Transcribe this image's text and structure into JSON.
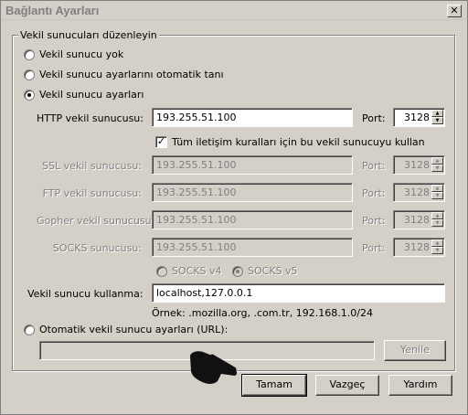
{
  "window": {
    "title": "Bağlantı Ayarları",
    "close_glyph": "✕"
  },
  "group": {
    "legend": "Vekil sunucuları düzenleyin"
  },
  "radios": {
    "no_proxy": "Vekil sunucu yok",
    "auto_detect": "Vekil sunucu ayarlarını otomatik tanı",
    "manual": "Vekil sunucu ayarları",
    "auto_url": "Otomatik vekil sunucu ayarları (URL):"
  },
  "selected_mode": "manual",
  "port_label": "Port:",
  "rows": [
    {
      "label": "HTTP vekil sunucusu:",
      "host": "193.255.51.100",
      "port": "3128",
      "enabled": true
    },
    {
      "label": "SSL vekil sunucusu:",
      "host": "193.255.51.100",
      "port": "3128",
      "enabled": false
    },
    {
      "label": "FTP vekil sunucusu:",
      "host": "193.255.51.100",
      "port": "3128",
      "enabled": false
    },
    {
      "label": "Gopher vekil sunucusu:",
      "host": "193.255.51.100",
      "port": "3128",
      "enabled": false
    },
    {
      "label": "SOCKS sunucusu:",
      "host": "193.255.51.100",
      "port": "3128",
      "enabled": false
    }
  ],
  "share_checkbox": {
    "label": "Tüm iletişim kuralları için bu vekil sunucuyu kullan",
    "checked": true,
    "glyph": "✓"
  },
  "socks": {
    "v4": "SOCKS v4",
    "v5": "SOCKS v5",
    "selected": "v5"
  },
  "no_proxy_for": {
    "label": "Vekil sunucu kullanma:",
    "value": "localhost,127.0.0.1"
  },
  "example": "Örnek: .mozilla.org, .com.tr, 192.168.1.0/24",
  "auto_url_value": "",
  "buttons": {
    "reload": "Yenile",
    "ok": "Tamam",
    "cancel": "Vazgeç",
    "help": "Yardım"
  },
  "icons": {
    "cursor": "hand-pointer-icon",
    "spin_up": "▲",
    "spin_down": "▼"
  }
}
